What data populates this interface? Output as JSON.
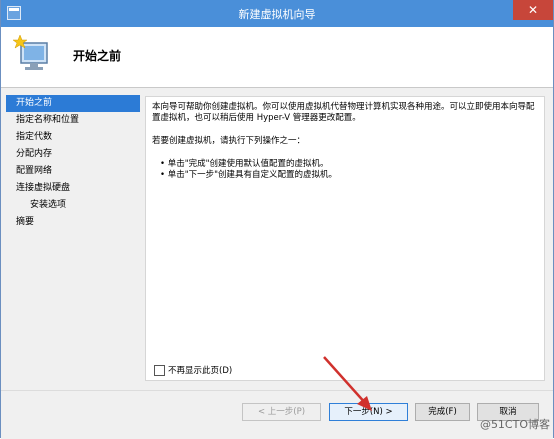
{
  "window": {
    "title": "新建虚拟机向导",
    "close_glyph": "✕"
  },
  "header": {
    "title": "开始之前",
    "icon": "monitor-with-star-icon"
  },
  "nav": {
    "items": [
      {
        "label": "开始之前",
        "active": true
      },
      {
        "label": "指定名称和位置",
        "active": false
      },
      {
        "label": "指定代数",
        "active": false
      },
      {
        "label": "分配内存",
        "active": false
      },
      {
        "label": "配置网络",
        "active": false
      },
      {
        "label": "连接虚拟硬盘",
        "active": false
      },
      {
        "label": "安装选项",
        "active": false
      },
      {
        "label": "摘要",
        "active": false
      }
    ]
  },
  "content": {
    "intro": "本向导可帮助你创建虚拟机。你可以使用虚拟机代替物理计算机实现各种用途。可以立即使用本向导配置虚拟机，也可以稍后使用 Hyper-V 管理器更改配置。",
    "instruction": "若要创建虚拟机，请执行下列操作之一：",
    "bullets": [
      "• 单击\"完成\"创建使用默认值配置的虚拟机。",
      "• 单击\"下一步\"创建具有自定义配置的虚拟机。"
    ],
    "checkbox_label": "不再显示此页(D)"
  },
  "footer": {
    "prev_label": "< 上一步(P)",
    "next_label": "下一步(N) >",
    "finish_label": "完成(F)",
    "cancel_label": "取消"
  },
  "watermark": "@51CTO博客",
  "colors": {
    "titlebar": "#4a8fd9",
    "nav_active": "#2c7bd6",
    "annotation_arrow": "#d0312d"
  }
}
